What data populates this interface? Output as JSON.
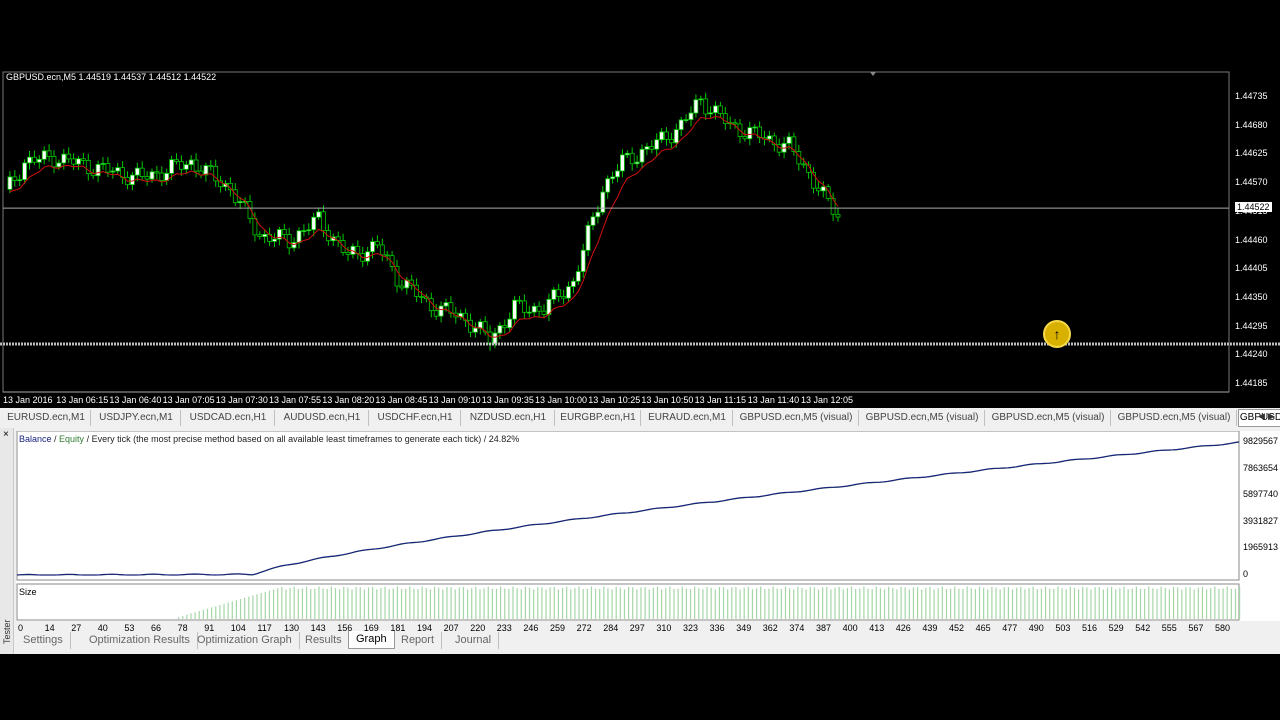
{
  "chart": {
    "title": "GBPUSD.ecn,M5  1.44519 1.44537 1.44512 1.44522",
    "symbol": "GBPUSD.ecn,M5",
    "ohlc": {
      "open": 1.44519,
      "high": 1.44537,
      "low": 1.44512,
      "close": 1.44522
    },
    "current_price": "1.44522",
    "price_levels": [
      "1.44735",
      "1.44680",
      "1.44625",
      "1.44570",
      "1.44515",
      "1.44460",
      "1.44405",
      "1.44350",
      "1.44295",
      "1.44240",
      "1.44185"
    ],
    "time_labels": [
      "13 Jan 2016",
      "13 Jan 06:15",
      "13 Jan 06:40",
      "13 Jan 07:05",
      "13 Jan 07:30",
      "13 Jan 07:55",
      "13 Jan 08:20",
      "13 Jan 08:45",
      "13 Jan 09:10",
      "13 Jan 09:35",
      "13 Jan 10:00",
      "13 Jan 10:25",
      "13 Jan 10:50",
      "13 Jan 11:15",
      "13 Jan 11:40",
      "13 Jan 12:05"
    ],
    "colors": {
      "background": "#000000",
      "bull_candle": "#ffffff",
      "bear_candle": "#000000",
      "wick": "#00c800",
      "moving_average": "#d01010"
    }
  },
  "chart_tabs": [
    {
      "label": "EURUSD.ecn,M1",
      "active": false
    },
    {
      "label": "USDJPY.ecn,M1",
      "active": false
    },
    {
      "label": "USDCAD.ecn,H1",
      "active": false
    },
    {
      "label": "AUDUSD.ecn,H1",
      "active": false
    },
    {
      "label": "USDCHF.ecn,H1",
      "active": false
    },
    {
      "label": "NZDUSD.ecn,H1",
      "active": false
    },
    {
      "label": "EURGBP.ecn,H1",
      "active": false
    },
    {
      "label": "EURAUD.ecn,M1",
      "active": false
    },
    {
      "label": "GBPUSD.ecn,M5 (visual)",
      "active": false
    },
    {
      "label": "GBPUSD.ecn,M5 (visual)",
      "active": false
    },
    {
      "label": "GBPUSD.ecn,M5 (visual)",
      "active": false
    },
    {
      "label": "GBPUSD.ecn,M5 (visual)",
      "active": false
    },
    {
      "label": "GBPUSD",
      "active": true
    }
  ],
  "tester": {
    "side_label": "Tester",
    "close_icon": "×",
    "legend": {
      "balance": "Balance",
      "sep": " / ",
      "equity": "Equity",
      "rest": " / Every tick (the most precise method based on all available least timeframes to generate each tick) / 24.82%"
    },
    "size_label": "Size",
    "y_labels": [
      "9829567",
      "7863654",
      "5897740",
      "3931827",
      "1965913",
      "0"
    ],
    "x_labels": [
      "0",
      "14",
      "27",
      "40",
      "53",
      "66",
      "78",
      "91",
      "104",
      "117",
      "130",
      "143",
      "156",
      "169",
      "181",
      "194",
      "207",
      "220",
      "233",
      "246",
      "259",
      "272",
      "284",
      "297",
      "310",
      "323",
      "336",
      "349",
      "362",
      "374",
      "387",
      "400",
      "413",
      "426",
      "439",
      "452",
      "465",
      "477",
      "490",
      "503",
      "516",
      "529",
      "542",
      "555",
      "567",
      "580"
    ],
    "tabs": [
      {
        "label": "Settings",
        "active": false
      },
      {
        "label": "Optimization Results",
        "active": false
      },
      {
        "label": "Optimization Graph",
        "active": false
      },
      {
        "label": "Results",
        "active": false
      },
      {
        "label": "Graph",
        "active": true
      },
      {
        "label": "Report",
        "active": false
      },
      {
        "label": "Journal",
        "active": false
      }
    ],
    "colors": {
      "balance": "#1a237e",
      "equity": "#2e7d32",
      "size_bars": "#a5d6a7"
    }
  },
  "icons": {
    "cursor": "mouse-cursor-highlight-icon",
    "scroll_left": "◀",
    "scroll_right": "▶",
    "cursor_glyph": "↑"
  }
}
